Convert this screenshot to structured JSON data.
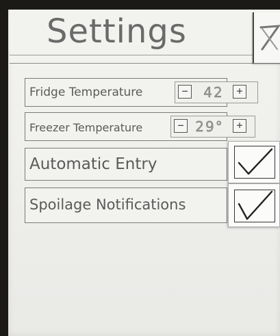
{
  "header": {
    "title": "Settings"
  },
  "settings": [
    {
      "label": "Fridge Temperature",
      "control": "stepper",
      "value": "42",
      "minus": "−",
      "plus": "+"
    },
    {
      "label": "Freezer Temperature",
      "control": "stepper",
      "value": "29°",
      "minus": "−",
      "plus": "+"
    },
    {
      "label": "Automatic Entry",
      "control": "checkbox",
      "checked": true
    },
    {
      "label": "Spoilage Notifications",
      "control": "checkbox",
      "checked": true
    }
  ],
  "icons": {
    "close": "close-icon",
    "check": "checkmark-icon"
  }
}
